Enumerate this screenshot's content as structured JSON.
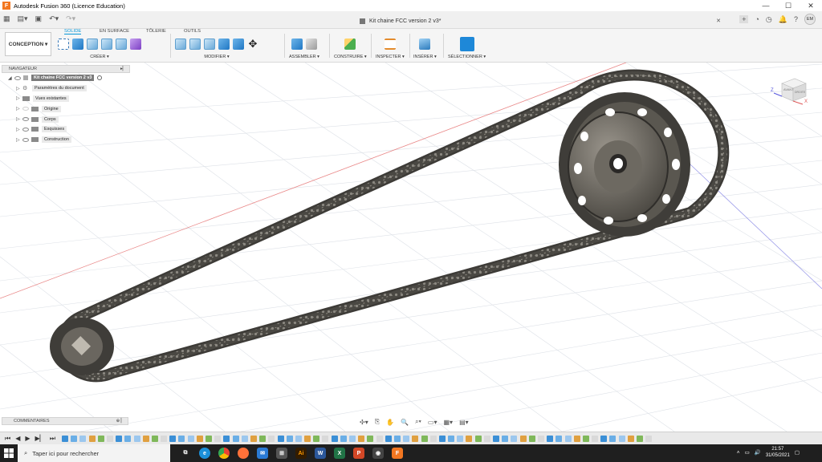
{
  "window": {
    "app_title": "Autodesk Fusion 360 (Licence Education)",
    "minimize": "—",
    "maximize": "☐",
    "close": "✕"
  },
  "appbar": {
    "document_title": "Kit chaine FCC version 2 v3*",
    "user_initials": "EM"
  },
  "ribbon": {
    "workspace": "CONCEPTION ▾",
    "tabs": [
      "SOLIDE",
      "EN SURFACE",
      "TÔLERIE",
      "OUTILS"
    ],
    "active_tab": "SOLIDE",
    "groups": {
      "create": "CRÉER ▾",
      "modify": "MODIFIER ▾",
      "assemble": "ASSEMBLER ▾",
      "construct": "CONSTRUIRE ▾",
      "inspect": "INSPECTER ▾",
      "insert": "INSÉRER ▾",
      "select": "SÉLECTIONNER ▾"
    }
  },
  "navigator": {
    "header": "NAVIGATEUR",
    "root": "Kit chaine FCC version 2 v3",
    "items": [
      {
        "label": "Paramètres du document",
        "icon": "gear-icon"
      },
      {
        "label": "Vues existantes",
        "icon": "folder-icon"
      },
      {
        "label": "Origine",
        "icon": "folder-icon"
      },
      {
        "label": "Corps",
        "icon": "folder-icon"
      },
      {
        "label": "Esquisses",
        "icon": "folder-icon"
      },
      {
        "label": "Construction",
        "icon": "folder-icon"
      }
    ]
  },
  "comments": {
    "label": "COMMENTAIRES"
  },
  "viewcube": {
    "face_front": "AVANT",
    "face_right": "DROITE",
    "axis_z": "Z",
    "axis_x": "X"
  },
  "taskbar": {
    "search_placeholder": "Taper ici pour rechercher",
    "time": "21:57",
    "date": "31/05/2021"
  },
  "colors": {
    "accent": "#0696d7",
    "chain": "#4a4843",
    "grid": "#d9dde3",
    "axis_red": "#e05555",
    "axis_blue": "#7070e0"
  }
}
